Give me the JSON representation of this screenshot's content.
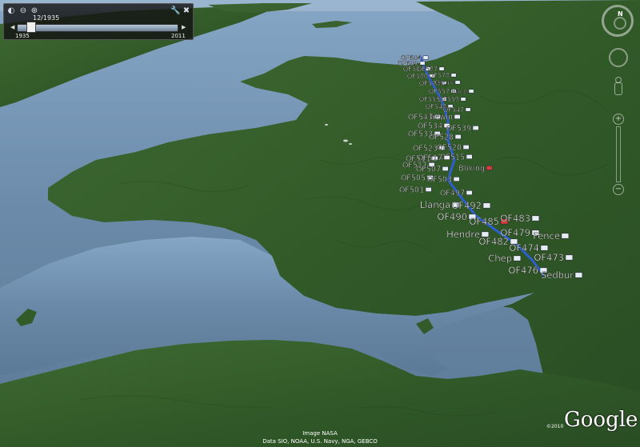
{
  "time_slider": {
    "current_date": "12/1935",
    "start_year": "1935",
    "end_year": "2011",
    "position": 0.0
  },
  "navigation": {
    "north_label": "N"
  },
  "credits": {
    "line1": "Image NASA",
    "line2": "Data SIO, NOAA, U.S. Navy, NGA, GEBCO",
    "copyright": "©2010",
    "logo_text": "Google"
  },
  "colors": {
    "sea": "#6d8aa8",
    "land": "#355f2a",
    "route": "#2d5fd0",
    "label": "#ffffff"
  },
  "placemarks": [
    {
      "label": "OF604",
      "size": 1
    },
    {
      "label": "OF600",
      "size": 1
    },
    {
      "label": "OF584",
      "size": 1
    },
    {
      "label": "OF587",
      "size": 1
    },
    {
      "label": "OF580",
      "size": 1
    },
    {
      "label": "OF578",
      "size": 1
    },
    {
      "label": "OF574",
      "size": 1
    },
    {
      "label": "Churk",
      "size": 1
    },
    {
      "label": "OF557",
      "size": 1
    },
    {
      "label": "Race",
      "size": 1
    },
    {
      "label": "OF555",
      "size": 1
    },
    {
      "label": "OF559",
      "size": 1
    },
    {
      "label": "OF548",
      "size": 1
    },
    {
      "label": "OF547",
      "size": 1
    },
    {
      "label": "OF543",
      "size": 2
    },
    {
      "label": "Trewin",
      "size": 2
    },
    {
      "label": "OF534",
      "size": 2
    },
    {
      "label": "OF539",
      "size": 2
    },
    {
      "label": "OF533",
      "size": 2
    },
    {
      "label": "OF528",
      "size": 2
    },
    {
      "label": "OF523",
      "size": 2
    },
    {
      "label": "OF520",
      "size": 2
    },
    {
      "label": "OF515",
      "size": 2
    },
    {
      "label": "OF511",
      "size": 2
    },
    {
      "label": "OF517",
      "size": 2
    },
    {
      "label": "Bbking",
      "size": 2
    },
    {
      "label": "OF511",
      "size": 2
    },
    {
      "label": "OF507",
      "size": 2
    },
    {
      "label": "OF505",
      "size": 2
    },
    {
      "label": "OF503",
      "size": 2
    },
    {
      "label": "OF501",
      "size": 2
    },
    {
      "label": "OF497",
      "size": 2
    },
    {
      "label": "Llanga",
      "size": 3
    },
    {
      "label": "OF492",
      "size": 3
    },
    {
      "label": "OF490",
      "size": 3
    },
    {
      "label": "OF485",
      "size": 3
    },
    {
      "label": "OF483",
      "size": 3
    },
    {
      "label": "Hendre",
      "size": 3
    },
    {
      "label": "OF479",
      "size": 3
    },
    {
      "label": "Fence",
      "size": 3
    },
    {
      "label": "OF482",
      "size": 3
    },
    {
      "label": "OF474",
      "size": 3
    },
    {
      "label": "Chep",
      "size": 3
    },
    {
      "label": "OF473",
      "size": 3
    },
    {
      "label": "OF476",
      "size": 3
    },
    {
      "label": "Sedbur",
      "size": 3
    }
  ]
}
